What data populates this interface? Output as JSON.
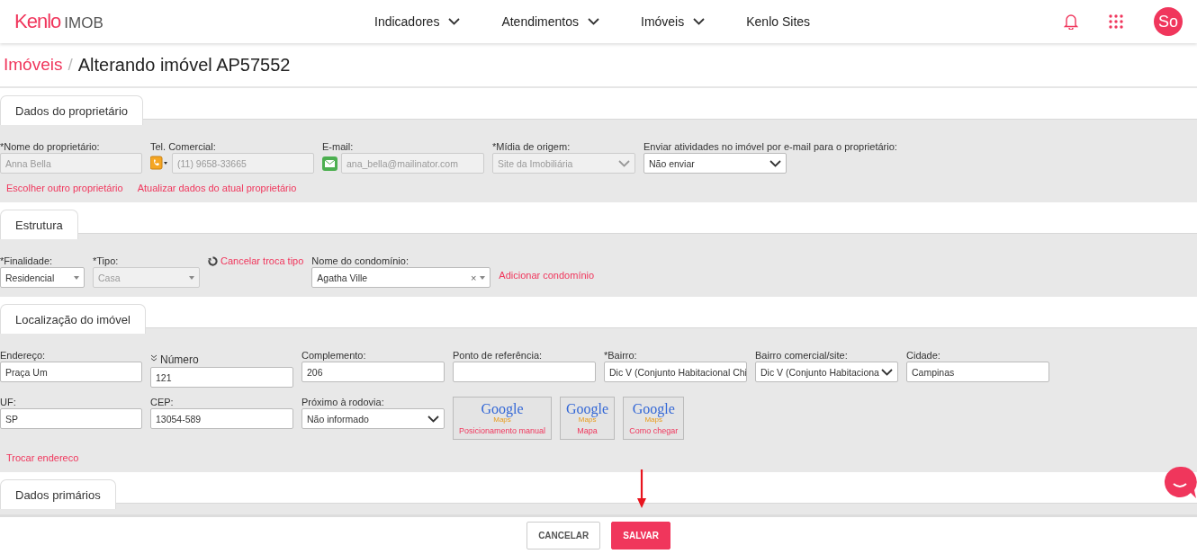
{
  "header": {
    "logo": {
      "brand": "Kenlo",
      "product": "IMOB"
    },
    "nav": [
      {
        "label": "Indicadores",
        "dropdown": true
      },
      {
        "label": "Atendimentos",
        "dropdown": true
      },
      {
        "label": "Imóveis",
        "dropdown": true
      },
      {
        "label": "Kenlo Sites",
        "dropdown": false
      }
    ],
    "avatar": "So"
  },
  "breadcrumb": {
    "parent": "Imóveis",
    "separator": "/",
    "current": "Alterando imóvel AP57552"
  },
  "sections": [
    {
      "title": "Dados do proprietário",
      "rows": [
        {
          "items": [
            {
              "kind": "input",
              "label": "*Nome do proprietário:",
              "value": "Anna Bella",
              "disabled": true
            },
            {
              "kind": "phone_input",
              "label": "Tel. Comercial:",
              "value": "(11) 9658-33665",
              "disabled": true
            },
            {
              "kind": "mail_input",
              "label": "E-mail:",
              "value": "ana_bella@mailinator.com",
              "disabled": true
            },
            {
              "kind": "select",
              "label": "*Mídia de origem:",
              "value": "Site da Imobiliária",
              "disabled": true
            },
            {
              "kind": "select",
              "label": "Enviar atividades no imóvel por e-mail para o proprietário:",
              "value": "Não enviar",
              "disabled": false
            }
          ]
        },
        {
          "items": [
            {
              "kind": "link",
              "text": "Escolher outro proprietário"
            },
            {
              "kind": "link",
              "text": "Atualizar dados do atual proprietário"
            }
          ]
        }
      ]
    },
    {
      "title": "Estrutura",
      "rows": [
        {
          "items": [
            {
              "kind": "small_select",
              "label": "*Finalidade:",
              "value": "Residencial",
              "disabled": false
            },
            {
              "kind": "small_select",
              "label": "*Tipo:",
              "value": "Casa",
              "disabled": true
            },
            {
              "kind": "undo_link",
              "text": "Cancelar troca tipo"
            },
            {
              "kind": "combo",
              "label": "Nome do condomínio:",
              "value": "Agatha Ville",
              "clear": "×",
              "disabled": false
            },
            {
              "kind": "link",
              "text": "Adicionar condomínio"
            }
          ]
        }
      ]
    },
    {
      "title": "Localização do imóvel",
      "rows": [
        {
          "items": [
            {
              "kind": "input",
              "label": "Endereço:",
              "value": "Praça Um",
              "disabled": false
            },
            {
              "kind": "sort_input",
              "label": "Número",
              "value": "121",
              "disabled": false
            },
            {
              "kind": "input",
              "label": "Complemento:",
              "value": "206",
              "disabled": false
            },
            {
              "kind": "input",
              "label": "Ponto de referência:",
              "disabled": false
            },
            {
              "kind": "input",
              "label": "*Bairro:",
              "value": "Dic V (Conjunto Habitacional Chi",
              "disabled": false
            },
            {
              "kind": "select",
              "label": "Bairro comercial/site:",
              "value": "Dic V (Conjunto Habitaciona",
              "disabled": false
            },
            {
              "kind": "input",
              "label": "Cidade:",
              "value": "Campinas",
              "disabled": false
            }
          ]
        },
        {
          "items": [
            {
              "kind": "input",
              "label": "UF:",
              "value": "SP",
              "disabled": false
            },
            {
              "kind": "input",
              "label": "CEP:",
              "value": "13054-589",
              "disabled": false
            },
            {
              "kind": "select",
              "label": "Próximo à rodovia:",
              "value": "Não informado",
              "disabled": false
            },
            {
              "kind": "map_button",
              "logo": "Google",
              "sub": "Maps",
              "text": "Posicionamento manual"
            },
            {
              "kind": "map_button",
              "logo": "Google",
              "sub": "Maps",
              "text": "Mapa"
            },
            {
              "kind": "map_button",
              "logo": "Google",
              "sub": "Maps",
              "text": "Como chegar"
            }
          ]
        },
        {
          "items": [
            {
              "kind": "link",
              "text": "Trocar endereco"
            }
          ]
        }
      ]
    },
    {
      "title": "Dados primários"
    }
  ],
  "footer": {
    "buttons": [
      {
        "label": "CANCELAR",
        "primary": false
      },
      {
        "label": "SALVAR",
        "primary": true
      }
    ]
  }
}
